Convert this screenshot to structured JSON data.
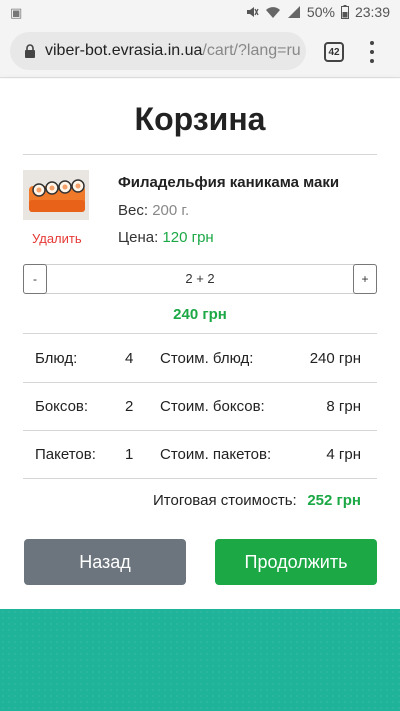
{
  "status_bar": {
    "battery": "50%",
    "time": "23:39"
  },
  "browser": {
    "url_host": "viber-bot.evrasia.in.ua",
    "url_path": "/cart/?lang=ru",
    "tab_count": "42"
  },
  "page": {
    "title": "Корзина"
  },
  "product": {
    "name": "Филадельфия каникама маки",
    "weight_label": "Вес:",
    "weight_value": "200 г.",
    "price_label": "Цена:",
    "price_value": "120 грн",
    "delete_label": "Удалить"
  },
  "stepper": {
    "minus": "-",
    "value": "2 + 2",
    "plus": "+"
  },
  "line_total": "240 грн",
  "summary": {
    "rows": [
      {
        "label": "Блюд:",
        "count": "4",
        "cost_label": "Стоим. блюд:",
        "cost": "240 грн"
      },
      {
        "label": "Боксов:",
        "count": "2",
        "cost_label": "Стоим. боксов:",
        "cost": "8 грн"
      },
      {
        "label": "Пакетов:",
        "count": "1",
        "cost_label": "Стоим. пакетов:",
        "cost": "4 грн"
      }
    ],
    "total_label": "Итоговая стоимость:",
    "total_value": "252 грн"
  },
  "buttons": {
    "back": "Назад",
    "continue": "Продолжить"
  },
  "colors": {
    "accent_green": "#1ba845",
    "delete_red": "#e53935",
    "back_gray": "#6c757d",
    "bottom_teal": "#1fb39a"
  }
}
